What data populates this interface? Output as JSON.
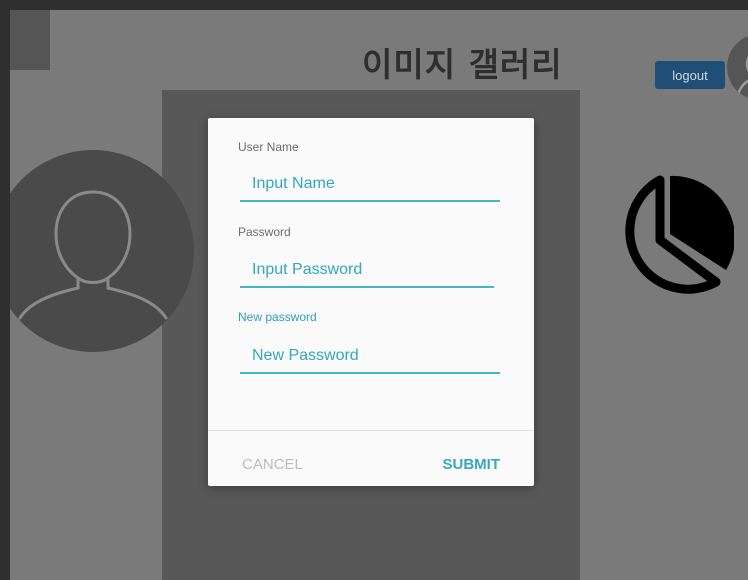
{
  "header": {
    "title": "이미지 갤러리",
    "logout_label": "logout"
  },
  "icons": {
    "top_avatar": "user-avatar-icon",
    "left_avatar": "user-silhouette-icon",
    "chart": "pie-chart-icon"
  },
  "dialog": {
    "user_name": {
      "label": "User Name",
      "placeholder": "Input Name",
      "value": ""
    },
    "password": {
      "label": "Password",
      "placeholder": "Input Password",
      "value": ""
    },
    "new_password": {
      "label": "New password",
      "placeholder": "New Password",
      "value": ""
    },
    "cancel_label": "CANCEL",
    "submit_label": "SUBMIT"
  },
  "colors": {
    "accent": "#35a8c0",
    "logout_bg": "#1f4e77",
    "overlay": "#7a7a7a"
  }
}
